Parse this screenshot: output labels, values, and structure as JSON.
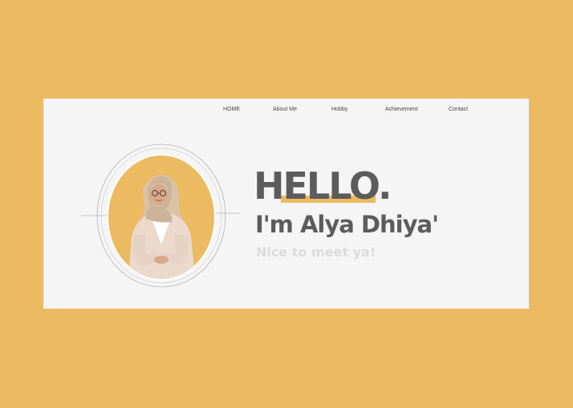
{
  "nav": {
    "items": [
      {
        "label": "HOME"
      },
      {
        "label": "About Me"
      },
      {
        "label": "Hobby"
      },
      {
        "label": "Achievement"
      },
      {
        "label": "Contact"
      }
    ]
  },
  "hero": {
    "greeting": "HELLO.",
    "name": "I'm Alya Dhiya'",
    "tagline": "Nice to meet ya!"
  },
  "colors": {
    "background": "#EBBA61",
    "card": "#F5F5F5",
    "accent": "#EBBA61",
    "text_dark": "#5C5C5C",
    "text_light": "#DCDCDC"
  },
  "icons": {
    "portrait": "person-portrait"
  }
}
